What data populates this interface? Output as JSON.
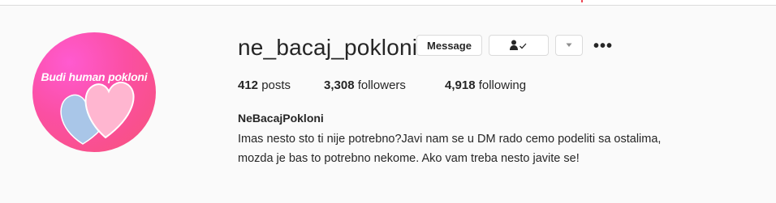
{
  "profile": {
    "avatar_text": "Budi human pokloni",
    "username": "ne_bacaj_pokloni",
    "full_name": "NeBacajPokloni",
    "bio_lines": [
      "Imas nesto sto ti nije potrebno?Javi nam se u DM rado cemo podeliti sa ostalima,",
      "mozda je bas to potrebno nekome. Ako vam treba nesto javite se!"
    ]
  },
  "actions": {
    "message_label": "Message",
    "follow_icon": "person-check-icon",
    "dropdown_icon": "triangle-down-icon",
    "more_icon": "more-options-icon",
    "more_glyph": "•••"
  },
  "stats": {
    "posts_count": "412",
    "posts_label": "posts",
    "followers_count": "3,308",
    "followers_label": "followers",
    "following_count": "4,918",
    "following_label": "following"
  },
  "colors": {
    "background": "#fafafa",
    "avatar_pink": "#fb4fa3",
    "heart_pink": "#ffb6d0",
    "heart_blue": "#a9c6e8",
    "top_accent": "#ed4956"
  }
}
